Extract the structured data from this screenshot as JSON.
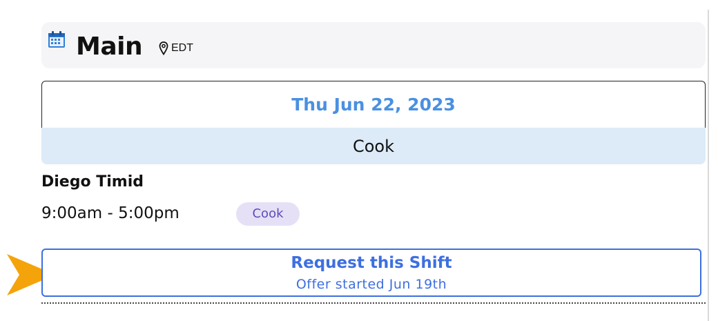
{
  "header": {
    "calendar_icon": "calendar-icon",
    "title": "Main",
    "location_icon": "map-pin-icon",
    "timezone": "EDT"
  },
  "day": {
    "date": "Thu Jun 22, 2023",
    "role_group": "Cook"
  },
  "shift": {
    "employee_name": "Diego Timid",
    "time_range": "9:00am - 5:00pm",
    "role_tag": "Cook"
  },
  "request": {
    "button_label": "Request this Shift",
    "sub_label": "Offer started Jun 19th"
  },
  "colors": {
    "accent_blue": "#3d6fe0",
    "date_blue": "#4a90e2",
    "role_bar_bg": "#dcebf7",
    "pill_bg": "#e6e0f7",
    "pill_text": "#5b4db8",
    "pointer_arrow": "#f5a30a"
  },
  "annotation": {
    "pointer_icon": "pointer-arrow-icon"
  }
}
